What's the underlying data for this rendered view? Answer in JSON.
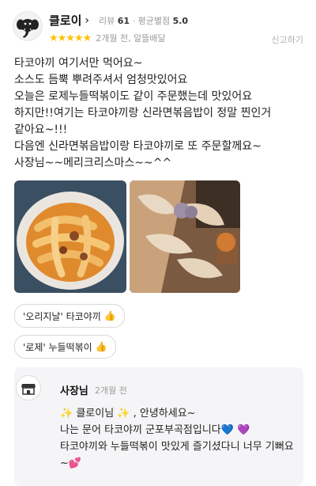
{
  "header": {
    "nickname": "클로이",
    "meta_reviews_label": "리뷰",
    "meta_reviews_value": "61",
    "meta_avg_label": "평균별점",
    "meta_avg_value": "5.0",
    "rating_stars": 5,
    "date": "2개월 전, 알뜰배달",
    "report_label": "신고하기",
    "avatar_icon": "elephant-avatar-icon"
  },
  "review": {
    "text": "타코야끼 여기서만 먹어요~\n소스도 듬뿍 뿌려주셔서 엄청맛있어요\n오늘은 로제누들떡볶이도 같이 주문했는데 맛있어요\n하지만!!여기는 타코야끼랑 신라면볶음밥이 정말 찐인거 같아요~!!!\n다음엔 신라면볶음밥이랑 타코야끼로 또 주문할께요~\n사장님~~메리크리스마스~~^^"
  },
  "tags": [
    {
      "label": "'오리지날' 타코야끼",
      "icon": "thumbs-up-icon"
    },
    {
      "label": "'로제' 누들떡볶이",
      "icon": "thumbs-up-icon"
    }
  ],
  "owner_reply": {
    "name": "사장님",
    "date": "2개월 전",
    "icon": "store-icon",
    "text": "✨ 클로이님 ✨ , 안녕하세요~\n나는 문어 타코야끼 군포부곡점입니다💙 💜\n타코야끼와 누들떡볶이 맛있게 즐기셨다니 너무 기뻐요~💕"
  },
  "colors": {
    "star": "#ffc107",
    "muted_text": "#9a9a9a",
    "reply_bg": "#f5f5f7"
  }
}
